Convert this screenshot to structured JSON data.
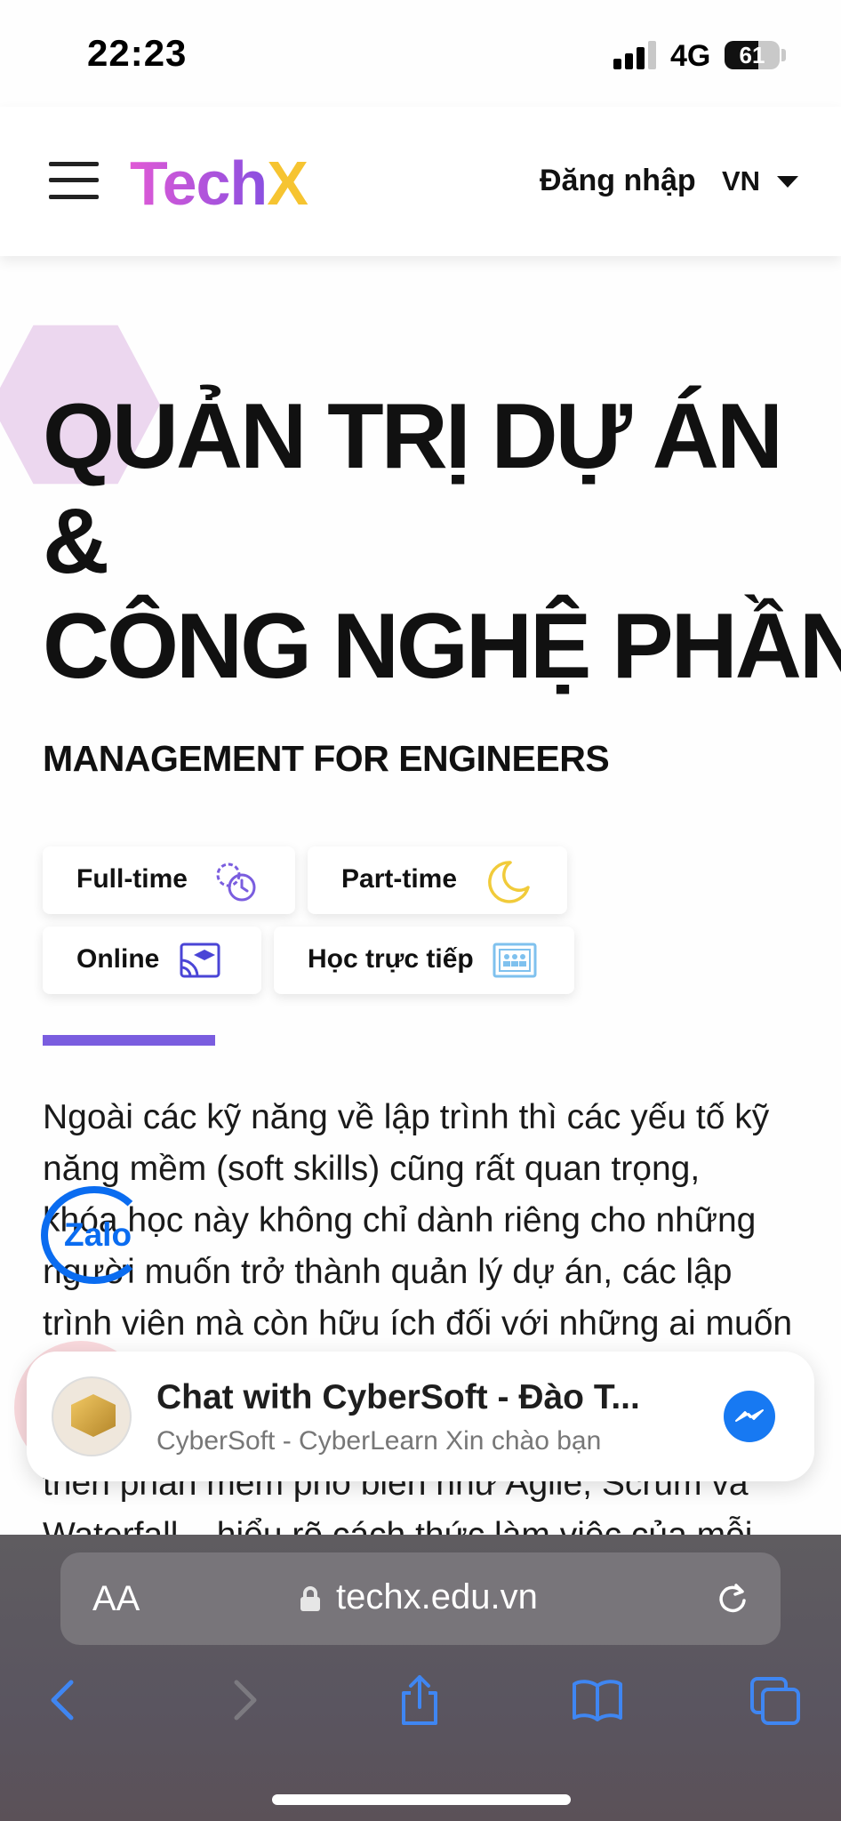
{
  "status_bar": {
    "time": "22:23",
    "network": "4G",
    "battery": "61",
    "battery_fraction": 0.61
  },
  "header": {
    "logo_part1": "Tech",
    "logo_part2": "X",
    "login_label": "Đăng nhập",
    "language": "VN"
  },
  "hero": {
    "title_lines": [
      "QUẢN TRỊ DỰ ÁN",
      "&",
      "CÔNG NGHỆ PHẦN"
    ],
    "subtitle": "MANAGEMENT FOR ENGINEERS"
  },
  "chips": [
    {
      "label": "Full-time",
      "icon": "clock-gears-icon"
    },
    {
      "label": "Part-time",
      "icon": "moon-icon"
    },
    {
      "label": "Online",
      "icon": "online-class-icon"
    },
    {
      "label": "Học trực tiếp",
      "icon": "classroom-icon"
    }
  ],
  "description_lines": [
    "Ngoài các kỹ năng về lập trình thì các yếu tố kỹ",
    "năng mềm (soft skills) cũng rất quan trọng,",
    "khóa học này không chỉ dành riêng cho những",
    "người muốn trở thành quản lý dự án, các lập",
    "trình viên mà còn hữu ích đối với những ai muốn"
  ],
  "description_lines_below": [
    "triển phần mềm phổ biến như Agile, Scrum và",
    "Waterfall – hiểu rõ cách thức làm việc của mỗi"
  ],
  "zalo": {
    "label": "Zalo"
  },
  "chat_widget": {
    "title": "Chat with CyberSoft - Đào T...",
    "subtitle": "CyberSoft - CyberLearn Xin chào bạn"
  },
  "browser": {
    "text_size_label": "AA",
    "url": "techx.edu.vn"
  },
  "colors": {
    "accent": "#7a5ddf",
    "logo_gradient_start": "#e05ad6",
    "logo_gradient_end": "#8a4fe0",
    "logo_x": "#f6c431",
    "zalo_blue": "#0a6cf0",
    "messenger_blue": "#1779f2",
    "browser_icon_blue": "#3f86f2"
  }
}
